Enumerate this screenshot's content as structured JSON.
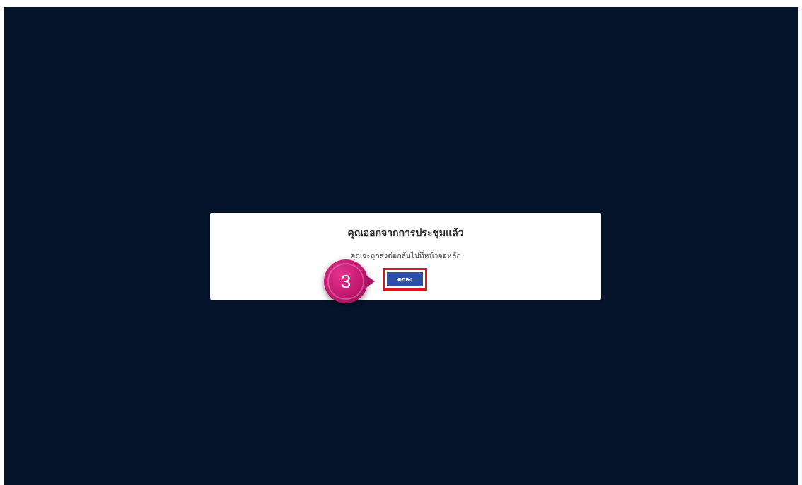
{
  "dialog": {
    "title": "คุณออกจากการประชุมแล้ว",
    "message": "คุณจะถูกส่งต่อกลับไปที่หน้าจอหลัก",
    "ok_label": "ตกลง"
  },
  "annotation": {
    "step_number": "3"
  },
  "colors": {
    "background": "#06142b",
    "button": "#2d4fa8",
    "highlight": "#e0141e",
    "badge": "#c2176f"
  }
}
